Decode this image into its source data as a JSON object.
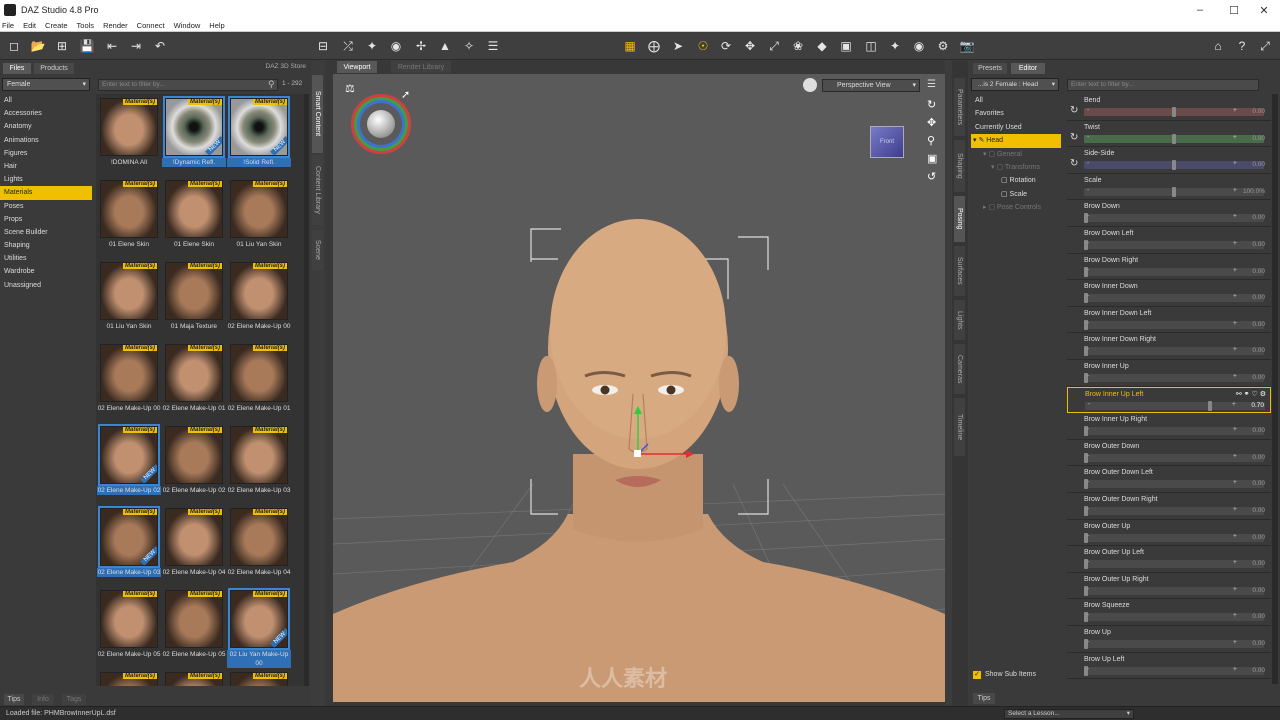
{
  "window": {
    "title": "DAZ Studio 4.8 Pro"
  },
  "menu": [
    "File",
    "Edit",
    "Create",
    "Tools",
    "Render",
    "Connect",
    "Window",
    "Help"
  ],
  "left_panel": {
    "tabs": [
      "Files",
      "Products"
    ],
    "store": "DAZ 3D Store",
    "filter_combo": "Female",
    "filter_placeholder": "Enter text to filter by...",
    "count": "1 - 292",
    "categories": [
      "All",
      "Accessories",
      "Anatomy",
      "Animations",
      "Figures",
      "Hair",
      "Lights",
      "Materials",
      "Poses",
      "Props",
      "Scene Builder",
      "Shaping",
      "Utilities",
      "Wardrobe",
      "Unassigned"
    ],
    "selected_category": "Materials",
    "thumbs": [
      {
        "label": "!DOMINA All",
        "badge": "Material(s)",
        "new": false,
        "sel": false,
        "kind": "face"
      },
      {
        "label": "!Dynamic Refl.",
        "badge": "Material(s)",
        "new": true,
        "sel": true,
        "kind": "eye"
      },
      {
        "label": "!Solid Refl.",
        "badge": "Material(s)",
        "new": true,
        "sel": true,
        "kind": "eye"
      },
      {
        "label": "01 Elene Skin",
        "badge": "Material(s)",
        "new": false,
        "sel": false,
        "kind": "face"
      },
      {
        "label": "01 Elene Skin",
        "badge": "Material(s)",
        "new": false,
        "sel": false,
        "kind": "face"
      },
      {
        "label": "01 Liu Yan Skin",
        "badge": "Material(s)",
        "new": false,
        "sel": false,
        "kind": "face"
      },
      {
        "label": "01 Liu Yan Skin",
        "badge": "Material(s)",
        "new": false,
        "sel": false,
        "kind": "face"
      },
      {
        "label": "01 Maja Texture",
        "badge": "Material(s)",
        "new": false,
        "sel": false,
        "kind": "face"
      },
      {
        "label": "02 Elene Make-Up 00",
        "badge": "Material(s)",
        "new": false,
        "sel": false,
        "kind": "face"
      },
      {
        "label": "02 Elene Make-Up 00",
        "badge": "Material(s)",
        "new": false,
        "sel": false,
        "kind": "face"
      },
      {
        "label": "02 Elene Make-Up 01",
        "badge": "Material(s)",
        "new": false,
        "sel": false,
        "kind": "face"
      },
      {
        "label": "02 Elene Make-Up 01",
        "badge": "Material(s)",
        "new": false,
        "sel": false,
        "kind": "face"
      },
      {
        "label": "02 Elene Make-Up 02",
        "badge": "Material(s)",
        "new": true,
        "sel": true,
        "kind": "face"
      },
      {
        "label": "02 Elene Make-Up 02",
        "badge": "Material(s)",
        "new": false,
        "sel": false,
        "kind": "face"
      },
      {
        "label": "02 Elene Make-Up 03",
        "badge": "Material(s)",
        "new": false,
        "sel": false,
        "kind": "face"
      },
      {
        "label": "02 Elene Make-Up 03",
        "badge": "Material(s)",
        "new": true,
        "sel": true,
        "kind": "face"
      },
      {
        "label": "02 Elene Make-Up 04",
        "badge": "Material(s)",
        "new": false,
        "sel": false,
        "kind": "face"
      },
      {
        "label": "02 Elene Make-Up 04",
        "badge": "Material(s)",
        "new": false,
        "sel": false,
        "kind": "face"
      },
      {
        "label": "02 Elene Make-Up 05",
        "badge": "Material(s)",
        "new": false,
        "sel": false,
        "kind": "face"
      },
      {
        "label": "02 Elene Make-Up 05",
        "badge": "Material(s)",
        "new": false,
        "sel": false,
        "kind": "face"
      },
      {
        "label": "02 Liu Yan Make-Up 00",
        "badge": "Material(s)",
        "new": true,
        "sel": true,
        "kind": "face"
      },
      {
        "label": "",
        "badge": "Material(s)",
        "new": false,
        "sel": false,
        "kind": "face"
      },
      {
        "label": "",
        "badge": "Material(s)",
        "new": false,
        "sel": false,
        "kind": "face"
      },
      {
        "label": "",
        "badge": "Material(s)",
        "new": false,
        "sel": false,
        "kind": "face"
      }
    ],
    "side_tabs": [
      "Smart Content",
      "Content Library",
      "Scene"
    ],
    "bottom_tabs": [
      "Tips",
      "Info",
      "Tags"
    ]
  },
  "viewport": {
    "tabs": [
      "Viewport",
      "Render Library"
    ],
    "view": "Perspective View",
    "cube_label": "Front",
    "watermark": "人人素材"
  },
  "right_panel": {
    "top_tabs": [
      "Presets",
      "Editor"
    ],
    "side_tabs": [
      "Parameters",
      "Shaping",
      "Posing",
      "Surfaces",
      "Lights",
      "Cameras",
      "Timeline"
    ],
    "node_combo": "...is 2 Female : Head",
    "filter_placeholder": "Enter text to filter by...",
    "tree": [
      "All",
      "Favorites",
      "Currently Used",
      "Head",
      "General",
      "Transforms",
      "Rotation",
      "Scale",
      "Pose Controls"
    ],
    "show_sub": "Show Sub Items",
    "sliders": [
      {
        "label": "Bend",
        "value": "0.00",
        "pos": 0.5,
        "color": "#6b4a4a"
      },
      {
        "label": "Twist",
        "value": "0.00",
        "pos": 0.5,
        "color": "#4a6b4a"
      },
      {
        "label": "Side-Side",
        "value": "0.00",
        "pos": 0.5,
        "color": "#4a4a6b"
      },
      {
        "label": "Scale",
        "value": "100.0%",
        "pos": 0.5,
        "color": "#4a4a4a"
      },
      {
        "label": "Brow Down",
        "value": "0.00",
        "pos": 0.0,
        "color": "#4a4a4a"
      },
      {
        "label": "Brow Down Left",
        "value": "0.00",
        "pos": 0.0,
        "color": "#4a4a4a"
      },
      {
        "label": "Brow Down Right",
        "value": "0.00",
        "pos": 0.0,
        "color": "#4a4a4a"
      },
      {
        "label": "Brow Inner Down",
        "value": "0.00",
        "pos": 0.0,
        "color": "#4a4a4a"
      },
      {
        "label": "Brow Inner Down Left",
        "value": "0.00",
        "pos": 0.0,
        "color": "#4a4a4a"
      },
      {
        "label": "Brow Inner Down Right",
        "value": "0.00",
        "pos": 0.0,
        "color": "#4a4a4a"
      },
      {
        "label": "Brow Inner Up",
        "value": "0.00",
        "pos": 0.0,
        "color": "#4a4a4a"
      },
      {
        "label": "Brow Inner Up Left",
        "value": "0.70",
        "pos": 0.7,
        "color": "#4a4a4a",
        "active": true
      },
      {
        "label": "Brow Inner Up Right",
        "value": "0.00",
        "pos": 0.0,
        "color": "#4a4a4a"
      },
      {
        "label": "Brow Outer Down",
        "value": "0.00",
        "pos": 0.0,
        "color": "#4a4a4a"
      },
      {
        "label": "Brow Outer Down Left",
        "value": "0.00",
        "pos": 0.0,
        "color": "#4a4a4a"
      },
      {
        "label": "Brow Outer Down Right",
        "value": "0.00",
        "pos": 0.0,
        "color": "#4a4a4a"
      },
      {
        "label": "Brow Outer Up",
        "value": "0.00",
        "pos": 0.0,
        "color": "#4a4a4a"
      },
      {
        "label": "Brow Outer Up Left",
        "value": "0.00",
        "pos": 0.0,
        "color": "#4a4a4a"
      },
      {
        "label": "Brow Outer Up Right",
        "value": "0.00",
        "pos": 0.0,
        "color": "#4a4a4a"
      },
      {
        "label": "Brow Squeeze",
        "value": "0.00",
        "pos": 0.0,
        "color": "#4a4a4a"
      },
      {
        "label": "Brow Up",
        "value": "0.00",
        "pos": 0.0,
        "color": "#4a4a4a"
      },
      {
        "label": "Brow Up Left",
        "value": "0.00",
        "pos": 0.0,
        "color": "#4a4a4a"
      }
    ],
    "bottom_tab": "Tips"
  },
  "status": {
    "loaded": "Loaded file: PHMBrowInnerUpL.dsf",
    "lesson": "Select a Lesson..."
  }
}
